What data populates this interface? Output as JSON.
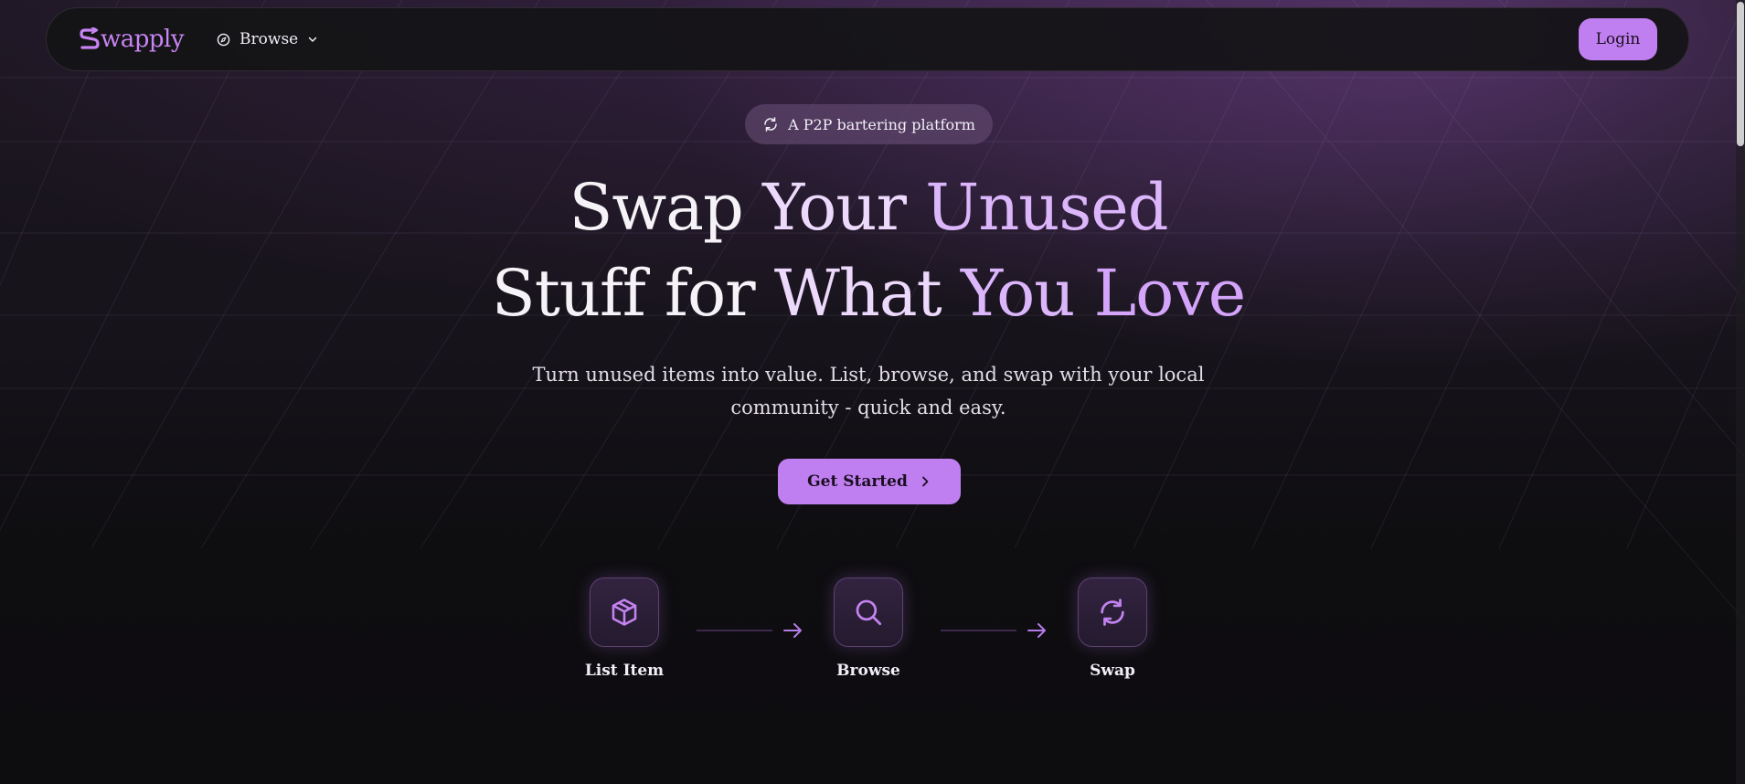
{
  "nav": {
    "logo_text": "wapply",
    "browse_label": "Browse",
    "login_label": "Login"
  },
  "hero": {
    "badge": "A P2P bartering platform",
    "title_line1": {
      "w1": "Swap",
      "w2": "Your",
      "w3": "Unused"
    },
    "title_line2": {
      "w1": "Stuff",
      "w2": "for",
      "w3": "What",
      "w4": "You",
      "w5": "Love"
    },
    "subtitle": "Turn unused items into value. List, browse, and swap with your local community - quick and easy.",
    "cta_label": "Get Started"
  },
  "steps": [
    {
      "label": "List Item",
      "icon": "box-icon"
    },
    {
      "label": "Browse",
      "icon": "search-icon"
    },
    {
      "label": "Swap",
      "icon": "refresh-icon"
    }
  ],
  "colors": {
    "accent": "#c07ff0",
    "background": "#0e0d10",
    "logo": "#c784f2"
  }
}
